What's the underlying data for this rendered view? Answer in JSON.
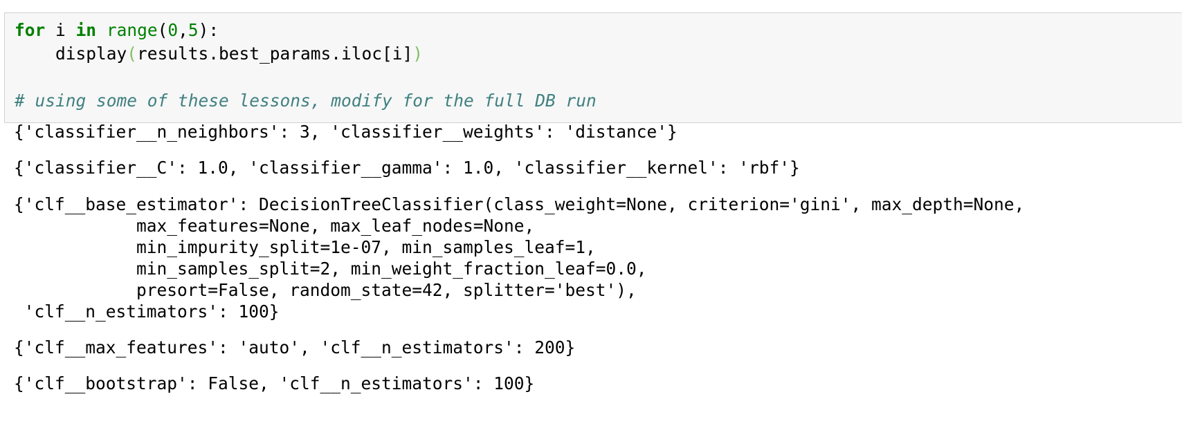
{
  "input_cell": {
    "line1": {
      "kw_for": "for",
      "var_i": " i ",
      "kw_in": "in",
      "space": " ",
      "builtin_range": "range",
      "open": "(",
      "start": "0",
      "comma": ",",
      "stop": "5",
      "close": "):"
    },
    "line2": {
      "indent_call": "    display",
      "open": "(",
      "arg": "results.best_params.iloc[i]",
      "close": ")"
    },
    "comment": "# using some of these lessons, modify for the full DB run"
  },
  "outputs": [
    "{'classifier__n_neighbors': 3, 'classifier__weights': 'distance'}",
    "{'classifier__C': 1.0, 'classifier__gamma': 1.0, 'classifier__kernel': 'rbf'}",
    "{'clf__base_estimator': DecisionTreeClassifier(class_weight=None, criterion='gini', max_depth=None,",
    "            max_features=None, max_leaf_nodes=None,",
    "            min_impurity_split=1e-07, min_samples_leaf=1,",
    "            min_samples_split=2, min_weight_fraction_leaf=0.0,",
    "            presort=False, random_state=42, splitter='best'),",
    " 'clf__n_estimators': 100}",
    "{'clf__max_features': 'auto', 'clf__n_estimators': 200}",
    "{'clf__bootstrap': False, 'clf__n_estimators': 100}"
  ]
}
